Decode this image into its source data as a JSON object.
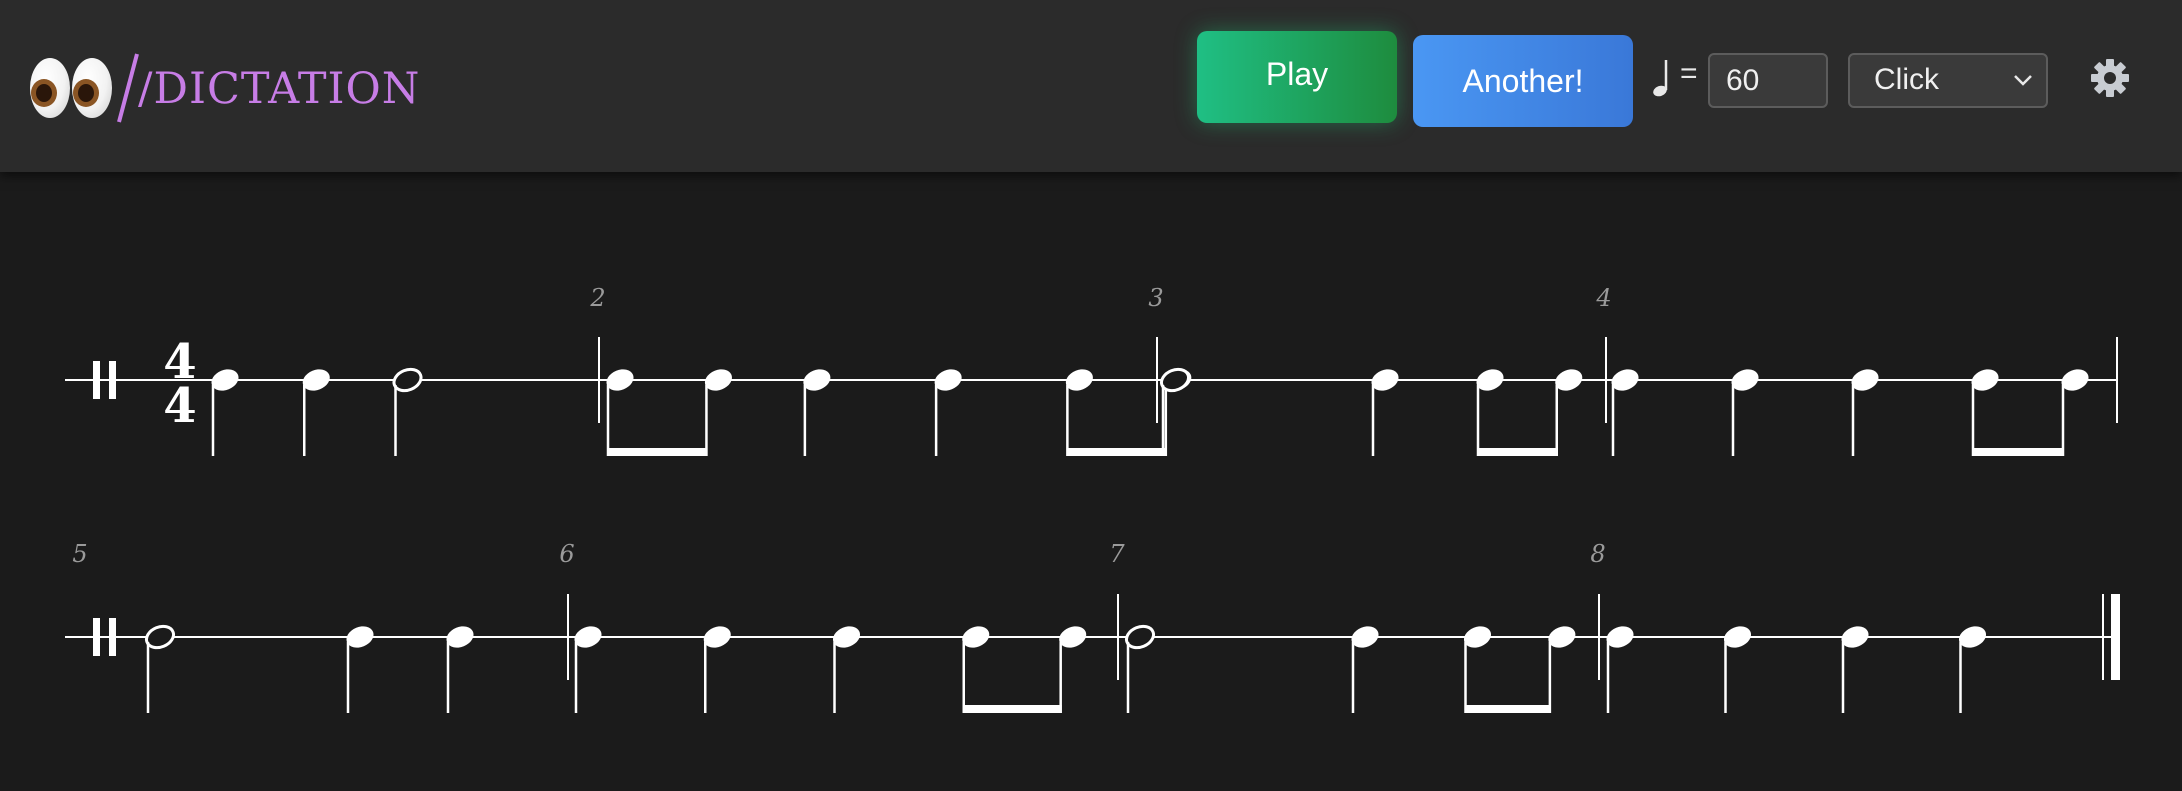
{
  "app": {
    "logo_text": "/DICTATION",
    "logo_icon": "eyes-emoji",
    "accent_color": "#c77de6"
  },
  "toolbar": {
    "play_label": "Play",
    "another_label": "Another!",
    "tempo_equals": "=",
    "tempo_value": "60",
    "sound_selected": "Click",
    "settings_icon": "gear-icon",
    "tempo_icon": "quarter-note-icon"
  },
  "score": {
    "time_signature": {
      "top": "4",
      "bottom": "4"
    },
    "measure_numbers": [
      "2",
      "3",
      "4",
      "5",
      "6",
      "7",
      "8"
    ],
    "measures": [
      [
        "q",
        "q",
        "h"
      ],
      [
        "8",
        "8",
        "q",
        "q",
        "8",
        "8"
      ],
      [
        "h",
        "q",
        "8",
        "8"
      ],
      [
        "q",
        "q",
        "q",
        "8",
        "8"
      ],
      [
        "h",
        "q",
        "q"
      ],
      [
        "q",
        "q",
        "q",
        "8",
        "8"
      ],
      [
        "h",
        "q",
        "8",
        "8"
      ],
      [
        "q",
        "q",
        "q",
        "q"
      ]
    ]
  }
}
